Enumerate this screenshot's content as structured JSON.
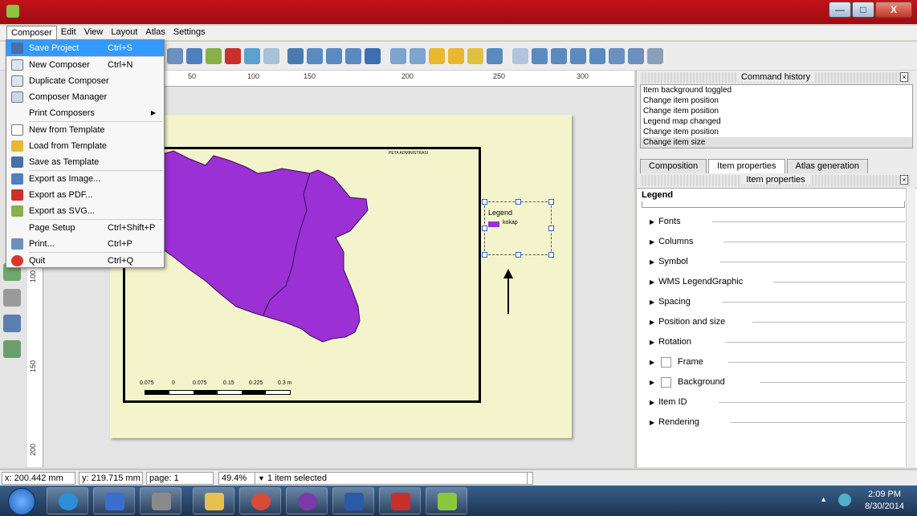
{
  "window": {
    "title": "",
    "buttons": [
      "—",
      "□",
      "X"
    ]
  },
  "menubar": [
    "Composer",
    "Edit",
    "View",
    "Layout",
    "Atlas",
    "Settings"
  ],
  "composer_menu": {
    "items": [
      {
        "label": "Save Project",
        "shortcut": "Ctrl+S",
        "icon": "save-icon"
      },
      {
        "label": "New Composer",
        "shortcut": "Ctrl+N",
        "icon": "new-composer-icon"
      },
      {
        "label": "Duplicate Composer",
        "shortcut": "",
        "icon": "duplicate-icon"
      },
      {
        "label": "Composer Manager",
        "shortcut": "",
        "icon": "composer-manager-icon"
      },
      {
        "label": "Print Composers",
        "shortcut": "",
        "icon": "",
        "submenu": true
      },
      {
        "label": "New from Template",
        "shortcut": "",
        "icon": "new-template-icon"
      },
      {
        "label": "Load from Template",
        "shortcut": "",
        "icon": "folder-icon"
      },
      {
        "label": "Save as Template",
        "shortcut": "",
        "icon": "save-template-icon"
      },
      {
        "label": "Export as Image...",
        "shortcut": "",
        "icon": "export-image-icon"
      },
      {
        "label": "Export as PDF...",
        "shortcut": "",
        "icon": "export-pdf-icon"
      },
      {
        "label": "Export as SVG...",
        "shortcut": "",
        "icon": "export-svg-icon"
      },
      {
        "label": "Page Setup",
        "shortcut": "Ctrl+Shift+P",
        "icon": ""
      },
      {
        "label": "Print...",
        "shortcut": "Ctrl+P",
        "icon": "print-icon"
      },
      {
        "label": "Quit",
        "shortcut": "Ctrl+Q",
        "icon": "quit-icon"
      }
    ]
  },
  "ruler": {
    "top_labels": [
      "50",
      "100",
      "150",
      "200",
      "250",
      "300"
    ],
    "left_labels": [
      "100",
      "150",
      "200"
    ]
  },
  "map": {
    "title": "PETA ADMINISTRASI",
    "scale_labels": [
      "0.075",
      "0",
      "0.075",
      "0.15",
      "0.225",
      "0.3 m"
    ],
    "fill_color": "#9b30d4"
  },
  "legend": {
    "title": "Legend",
    "item": "kokap"
  },
  "command_history": {
    "title": "Command history",
    "items": [
      "Item background toggled",
      "Change item position",
      "Change item position",
      "Legend map changed",
      "Change item position",
      "Change item size"
    ]
  },
  "tabs": [
    "Composition",
    "Item properties",
    "Atlas generation"
  ],
  "item_properties": {
    "title": "Item properties",
    "section": "Legend",
    "groups": [
      {
        "label": "Fonts",
        "checkbox": false
      },
      {
        "label": "Columns",
        "checkbox": false
      },
      {
        "label": "Symbol",
        "checkbox": false
      },
      {
        "label": "WMS LegendGraphic",
        "checkbox": false
      },
      {
        "label": "Spacing",
        "checkbox": false
      },
      {
        "label": "Position and size",
        "checkbox": false
      },
      {
        "label": "Rotation",
        "checkbox": false
      },
      {
        "label": "Frame",
        "checkbox": true
      },
      {
        "label": "Background",
        "checkbox": true
      },
      {
        "label": "Item ID",
        "checkbox": false
      },
      {
        "label": "Rendering",
        "checkbox": false
      }
    ]
  },
  "statusbar": {
    "x": "x: 200.442 mm",
    "y": "y: 219.715 mm",
    "page": "page: 1",
    "zoom": "49.4%",
    "selection": "1 item selected"
  },
  "taskbar": {
    "time": "2:09 PM",
    "date": "8/30/2014"
  }
}
